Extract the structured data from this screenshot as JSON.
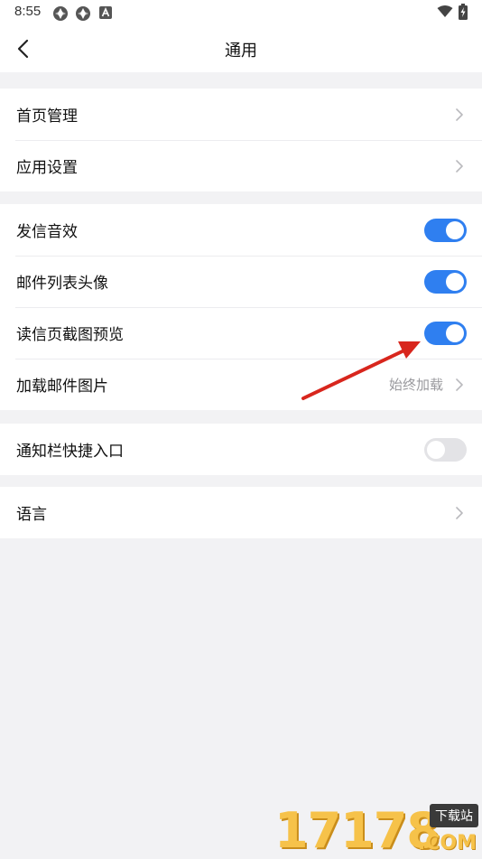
{
  "status_bar": {
    "time": "8:55",
    "icons": [
      "app-notification-icon",
      "app-notification-icon",
      "a-icon",
      "wifi-icon",
      "battery-charging-icon"
    ]
  },
  "header": {
    "title": "通用",
    "back_icon": "chevron-left-icon"
  },
  "groups": [
    {
      "items": [
        {
          "label": "首页管理",
          "type": "link"
        },
        {
          "label": "应用设置",
          "type": "link"
        }
      ]
    },
    {
      "items": [
        {
          "label": "发信音效",
          "type": "toggle",
          "on": true
        },
        {
          "label": "邮件列表头像",
          "type": "toggle",
          "on": true
        },
        {
          "label": "读信页截图预览",
          "type": "toggle",
          "on": true
        },
        {
          "label": "加载邮件图片",
          "type": "link",
          "value": "始终加载"
        }
      ]
    },
    {
      "items": [
        {
          "label": "通知栏快捷入口",
          "type": "toggle",
          "on": false
        }
      ]
    },
    {
      "items": [
        {
          "label": "语言",
          "type": "link"
        }
      ]
    }
  ],
  "colors": {
    "accent": "#2f7ff0",
    "toggle_off": "#e3e3e6",
    "background": "#f2f2f4",
    "annotation_arrow": "#d8261d"
  },
  "watermark": {
    "digits": "17178",
    "tag": "下载站",
    "suffix": ".COM"
  }
}
